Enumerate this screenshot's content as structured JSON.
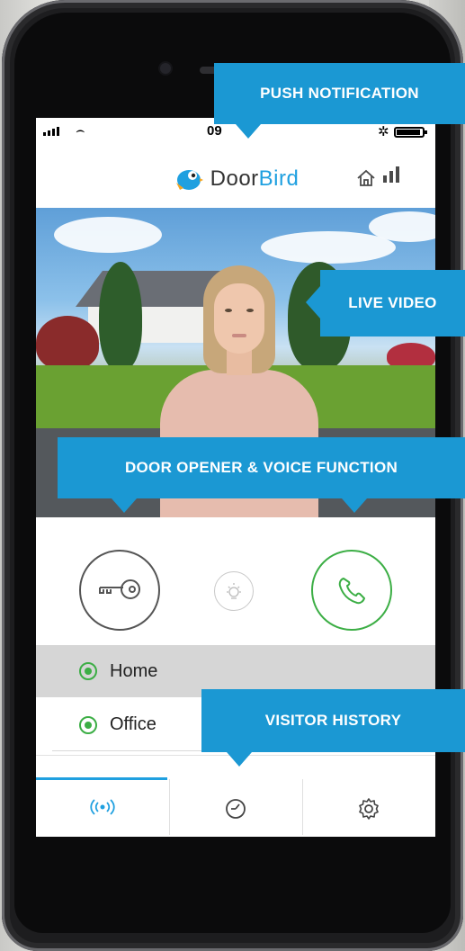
{
  "status_bar": {
    "time": "09"
  },
  "app_header": {
    "brand_part1": "Door",
    "brand_part2": "Bird"
  },
  "controls": {
    "door_opener_icon": "key-icon",
    "light_icon": "light-bulb-icon",
    "call_icon": "phone-icon"
  },
  "devices": [
    {
      "label": "Home",
      "selected": true
    },
    {
      "label": "Office",
      "selected": false
    }
  ],
  "tabs": [
    {
      "icon": "live-signal-icon",
      "active": true
    },
    {
      "icon": "clock-icon",
      "active": false
    },
    {
      "icon": "gear-icon",
      "active": false
    }
  ],
  "callouts": {
    "push": "PUSH NOTIFICATION",
    "video": "LIVE VIDEO",
    "door": "DOOR OPENER & VOICE FUNCTION",
    "history": "VISITOR HISTORY"
  },
  "colors": {
    "accent": "#1fa0e0",
    "callout": "#1b98d3",
    "green": "#3cae45"
  }
}
